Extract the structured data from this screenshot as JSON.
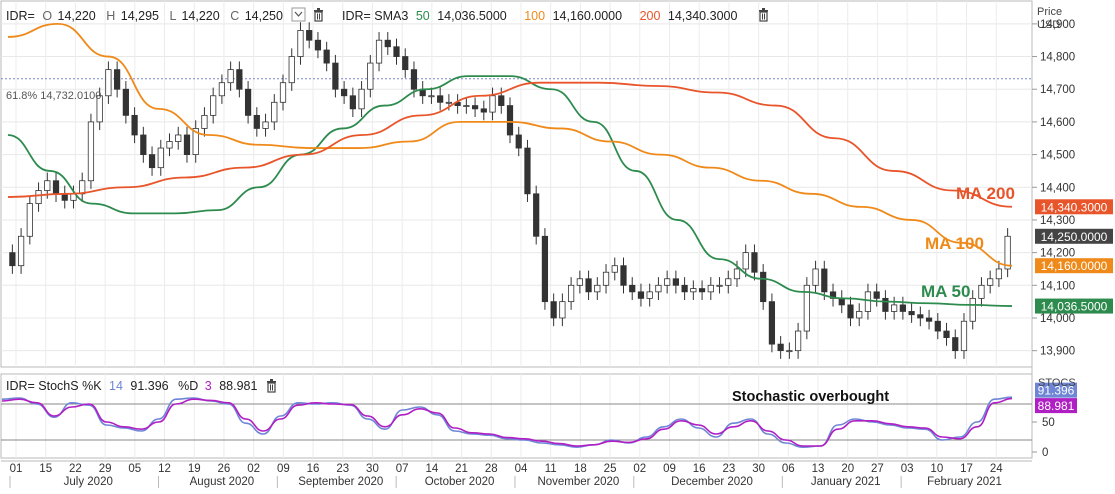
{
  "main_panel": {
    "legend": {
      "ric": "IDR=",
      "o_label": "O",
      "o_value": "14,220",
      "h_label": "H",
      "h_value": "14,295",
      "l_label": "L",
      "l_value": "14,220",
      "c_label": "C",
      "c_value": "14,250",
      "sma_label": "IDR= SMA3",
      "sma50_period": "50",
      "sma50_value": "14,036.5000",
      "sma100_period": "100",
      "sma100_value": "14,160.0000",
      "sma200_period": "200",
      "sma200_value": "14,340.3000"
    },
    "axis_title_1": "Price",
    "axis_title_2": "USD",
    "fib_label": "61.8%  14,732.0100",
    "annotations": {
      "ma200": "MA 200",
      "ma100": "MA 100",
      "ma50": "MA 50"
    },
    "badges": [
      {
        "text": "14,340.3000",
        "value": 14340.3,
        "color": "#e8552a"
      },
      {
        "text": "14,250.0000",
        "value": 14250,
        "color": "#444444"
      },
      {
        "text": "14,160.0000",
        "value": 14160,
        "color": "#ef8a1a"
      },
      {
        "text": "14,036.5000",
        "value": 14036.5,
        "color": "#2e8b4e"
      }
    ]
  },
  "stoch_panel": {
    "legend": {
      "label": "IDR= StochS %K",
      "k_period": "14",
      "k_value": "91.396",
      "d_label": "%D",
      "d_period": "3",
      "d_value": "88.981"
    },
    "axis_title": "STOCS",
    "annotation": "Stochastic overbought",
    "badges": [
      {
        "text": "91.396",
        "value": 91.396,
        "color": "#6f86d6"
      },
      {
        "text": "88.981",
        "value": 88.981,
        "color": "#b01fc4"
      }
    ]
  },
  "colors": {
    "ma50": "#2e8b4e",
    "ma100": "#ef8a1a",
    "ma200": "#e8552a",
    "stoch_k": "#6f86d6",
    "stoch_d": "#b01fc4",
    "fib": "#7a86c8",
    "candle": "#333333"
  },
  "chart_data": [
    {
      "type": "candlestick",
      "title": "",
      "ylabel": "Price USD",
      "ylim": [
        13850,
        14970
      ],
      "y_ticks": [
        "14,900",
        "14,800",
        "14,700",
        "14,600",
        "14,500",
        "14,400",
        "14,300",
        "14,200",
        "14,100",
        "14,000",
        "13,900"
      ],
      "y_tick_values": [
        14900,
        14800,
        14700,
        14600,
        14500,
        14400,
        14300,
        14200,
        14100,
        14000,
        13900
      ],
      "x_day_labels": [
        "01",
        "15",
        "22",
        "29",
        "05",
        "12",
        "19",
        "26",
        "02",
        "09",
        "16",
        "23",
        "30",
        "07",
        "14",
        "21",
        "28",
        "04",
        "11",
        "18",
        "25",
        "02",
        "09",
        "16",
        "23",
        "30",
        "06",
        "13",
        "20",
        "27",
        "03",
        "10",
        "17",
        "24"
      ],
      "x_month_labels": [
        "July 2020",
        "August 2020",
        "September 2020",
        "October 2020",
        "November 2020",
        "December 2020",
        "January 2021",
        "February 2021"
      ],
      "fib_level": {
        "label": "61.8%",
        "value": 14732.01
      },
      "candles_close": [
        14160,
        14250,
        14350,
        14390,
        14420,
        14380,
        14360,
        14380,
        14420,
        14600,
        14680,
        14760,
        14700,
        14620,
        14560,
        14500,
        14460,
        14520,
        14540,
        14560,
        14500,
        14580,
        14620,
        14680,
        14720,
        14760,
        14700,
        14620,
        14580,
        14600,
        14660,
        14720,
        14800,
        14880,
        14850,
        14820,
        14780,
        14700,
        14680,
        14640,
        14700,
        14780,
        14850,
        14830,
        14800,
        14760,
        14700,
        14680,
        14680,
        14660,
        14660,
        14650,
        14650,
        14640,
        14630,
        14680,
        14650,
        14560,
        14520,
        14380,
        14250,
        14050,
        14000,
        14050,
        14100,
        14120,
        14080,
        14100,
        14140,
        14160,
        14100,
        14080,
        14060,
        14080,
        14100,
        14120,
        14100,
        14080,
        14090,
        14080,
        14100,
        14100,
        14120,
        14150,
        14200,
        14140,
        14050,
        13920,
        13900,
        13900,
        13960,
        14100,
        14150,
        14080,
        14060,
        14040,
        14000,
        14020,
        14080,
        14060,
        14020,
        14040,
        14020,
        14010,
        14000,
        13990,
        13960,
        13940,
        13900,
        13990,
        14060,
        14100,
        14120,
        14150,
        14250
      ],
      "series": [
        {
          "name": "SMA3 50",
          "values": [
            14560,
            14450,
            14350,
            14320,
            14320,
            14330,
            14400,
            14500,
            14580,
            14650,
            14700,
            14740,
            14740,
            14700,
            14600,
            14450,
            14300,
            14180,
            14120,
            14080,
            14060,
            14050,
            14045,
            14040,
            14036.5
          ]
        },
        {
          "name": "SMA3 100",
          "values": [
            14860,
            14900,
            14800,
            14640,
            14560,
            14530,
            14520,
            14520,
            14540,
            14600,
            14600,
            14580,
            14540,
            14500,
            14460,
            14420,
            14380,
            14340,
            14300,
            14230,
            14160
          ]
        },
        {
          "name": "SMA3 200",
          "values": [
            14370,
            14380,
            14400,
            14430,
            14460,
            14500,
            14560,
            14620,
            14680,
            14720,
            14720,
            14710,
            14690,
            14650,
            14550,
            14450,
            14390,
            14340.3
          ]
        }
      ]
    },
    {
      "type": "line",
      "title": "",
      "ylabel": "STOCS",
      "ylim": [
        0,
        100
      ],
      "y_ticks": [
        "50",
        "0"
      ],
      "y_tick_values": [
        50,
        0
      ],
      "ref_lines": [
        80,
        20
      ],
      "series": [
        {
          "name": "%K",
          "values": [
            88,
            90,
            80,
            58,
            82,
            78,
            45,
            40,
            35,
            55,
            88,
            90,
            85,
            80,
            48,
            30,
            60,
            82,
            80,
            82,
            78,
            55,
            38,
            70,
            75,
            62,
            35,
            30,
            28,
            22,
            20,
            15,
            12,
            8,
            12,
            20,
            15,
            25,
            42,
            55,
            40,
            25,
            48,
            55,
            30,
            15,
            8,
            10,
            45,
            55,
            50,
            45,
            40,
            38,
            20,
            25,
            50,
            88,
            91.396
          ]
        },
        {
          "name": "%D",
          "values": [
            85,
            88,
            82,
            60,
            75,
            80,
            50,
            42,
            38,
            50,
            80,
            88,
            86,
            82,
            55,
            35,
            55,
            78,
            82,
            80,
            79,
            60,
            42,
            62,
            72,
            65,
            40,
            32,
            30,
            24,
            22,
            18,
            14,
            10,
            12,
            18,
            16,
            22,
            38,
            52,
            45,
            30,
            42,
            52,
            35,
            20,
            10,
            10,
            38,
            52,
            52,
            47,
            42,
            40,
            25,
            22,
            42,
            82,
            88.981
          ]
        }
      ]
    }
  ]
}
